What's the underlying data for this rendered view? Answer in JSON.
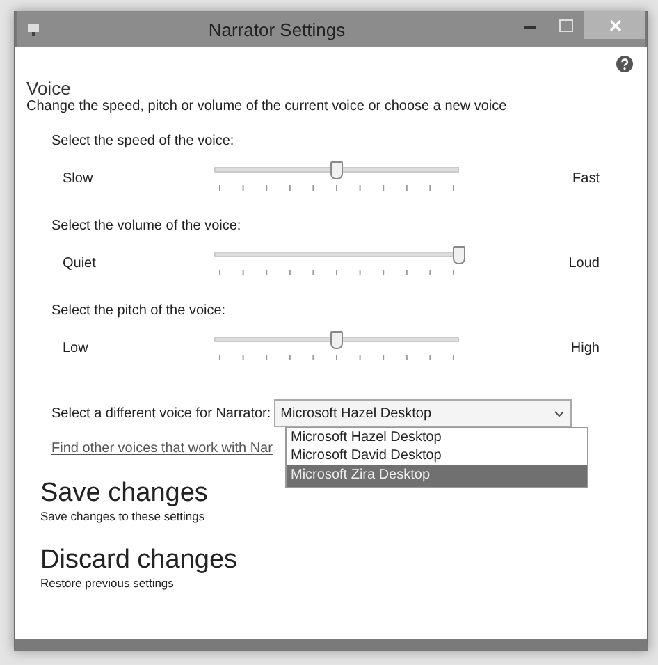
{
  "window": {
    "title": "Narrator Settings"
  },
  "voice": {
    "heading": "Voice",
    "description": "Change the speed, pitch or volume of the current voice or choose a new voice"
  },
  "sliders": [
    {
      "label": "Select the speed of the voice:",
      "min_label": "Slow",
      "max_label": "Fast",
      "level": 0.5
    },
    {
      "label": "Select the volume of the voice:",
      "min_label": "Quiet",
      "max_label": "Loud",
      "level": 1.0
    },
    {
      "label": "Select the pitch of the voice:",
      "min_label": "Low",
      "max_label": "High",
      "level": 0.5
    }
  ],
  "voice_select": {
    "label": "Select a different voice for Narrator:",
    "value": "Microsoft Hazel Desktop",
    "expanded": true,
    "options": [
      {
        "label": "Microsoft Hazel Desktop",
        "highlighted": false
      },
      {
        "label": "Microsoft David Desktop",
        "highlighted": false
      },
      {
        "label": "Microsoft Zira Desktop",
        "highlighted": true
      }
    ]
  },
  "link": "Find other voices that work with Nar",
  "actions": [
    {
      "title": "Save changes",
      "description": "Save changes to these settings"
    },
    {
      "title": "Discard changes",
      "description": "Restore previous settings"
    }
  ]
}
